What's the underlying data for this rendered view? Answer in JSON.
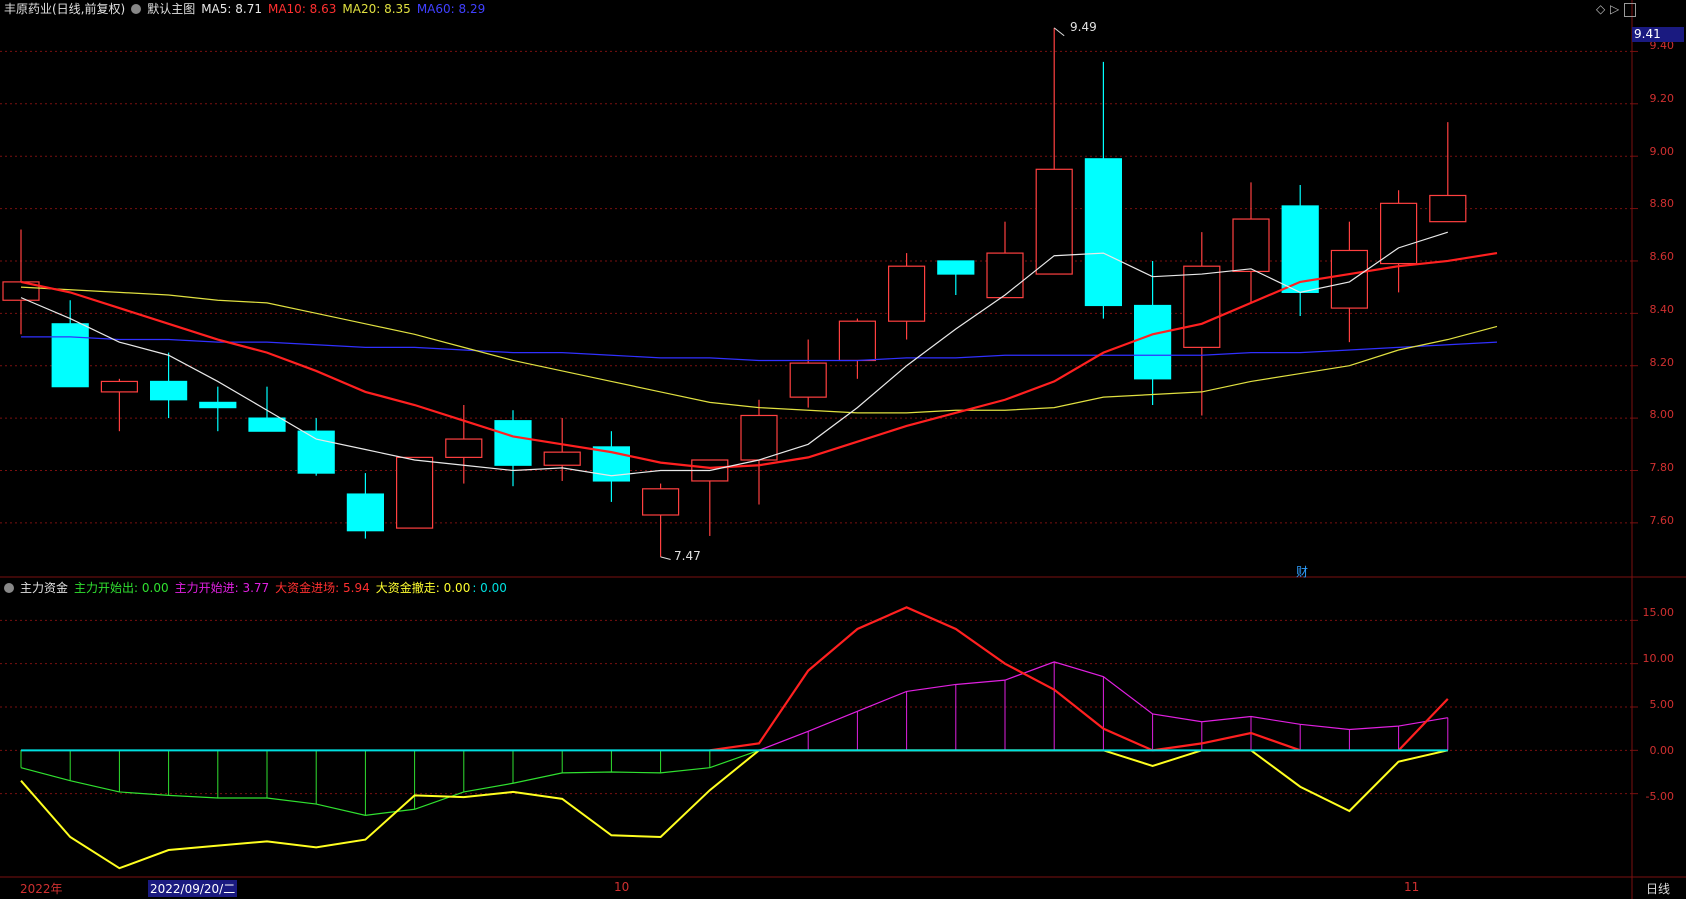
{
  "header": {
    "stock_title": "丰原药业(日线,前复权)",
    "main_chart_label": "默认主图",
    "ma5": "MA5: 8.71",
    "ma10": "MA10: 8.63",
    "ma20": "MA20: 8.35",
    "ma60": "MA60: 8.29"
  },
  "sub_header": {
    "indicator_name": "主力资金",
    "line1": "主力开始出: 0.00",
    "line2": "主力开始进: 3.77",
    "line3": "大资金进场: 5.94",
    "line4": "大资金撤走: 0.00",
    "line5": ": 0.00"
  },
  "price_panel": {
    "current_price_tag": "9.41",
    "high_annotation": "9.49",
    "low_annotation": "7.47",
    "event_marker": "财",
    "y_ticks": [
      "9.40",
      "9.20",
      "9.00",
      "8.80",
      "8.60",
      "8.40",
      "8.20",
      "8.00",
      "7.80",
      "7.60"
    ]
  },
  "indicator_panel": {
    "y_ticks": [
      "15.00",
      "10.00",
      "5.00",
      "0.00",
      "-5.00"
    ]
  },
  "x_axis": {
    "label_year": "2022年",
    "label_cursor": "2022/09/20/二",
    "label_oct": "10",
    "label_nov": "11",
    "period_label": "日线"
  },
  "colors": {
    "up": "#ff4040",
    "down": "#00ffff",
    "ma5": "#e8e8e8",
    "ma10": "#ff2020",
    "ma20": "#e0e040",
    "ma60": "#3030ff",
    "grid": "#7a1010",
    "ind_green": "#30e030",
    "ind_magenta": "#e020e0",
    "ind_red": "#ff2020",
    "ind_yellow": "#ffff20",
    "ind_cyan": "#00e0e0"
  },
  "chart_data": [
    {
      "type": "candlestick",
      "title": "丰原药业(日线,前复权)",
      "ylim": [
        7.42,
        9.52
      ],
      "ohlc": [
        [
          8.45,
          8.72,
          8.32,
          8.52
        ],
        [
          8.36,
          8.45,
          8.12,
          8.12
        ],
        [
          8.1,
          8.15,
          7.95,
          8.14
        ],
        [
          8.14,
          8.25,
          8.0,
          8.07
        ],
        [
          8.06,
          8.12,
          7.95,
          8.04
        ],
        [
          8.0,
          8.12,
          7.95,
          7.95
        ],
        [
          7.95,
          8.0,
          7.78,
          7.79
        ],
        [
          7.71,
          7.79,
          7.54,
          7.57
        ],
        [
          7.58,
          7.85,
          7.58,
          7.85
        ],
        [
          7.85,
          8.05,
          7.75,
          7.92
        ],
        [
          7.99,
          8.03,
          7.74,
          7.82
        ],
        [
          7.82,
          8.0,
          7.76,
          7.87
        ],
        [
          7.89,
          7.95,
          7.68,
          7.76
        ],
        [
          7.63,
          7.75,
          7.47,
          7.73
        ],
        [
          7.76,
          7.84,
          7.55,
          7.84
        ],
        [
          7.84,
          8.07,
          7.67,
          8.01
        ],
        [
          8.08,
          8.3,
          8.04,
          8.21
        ],
        [
          8.22,
          8.38,
          8.15,
          8.37
        ],
        [
          8.37,
          8.63,
          8.3,
          8.58
        ],
        [
          8.6,
          8.6,
          8.47,
          8.55
        ],
        [
          8.46,
          8.75,
          8.46,
          8.63
        ],
        [
          8.55,
          9.49,
          8.55,
          8.95
        ],
        [
          8.99,
          9.36,
          8.38,
          8.43
        ],
        [
          8.43,
          8.6,
          8.05,
          8.15
        ],
        [
          8.27,
          8.71,
          8.01,
          8.58
        ],
        [
          8.56,
          8.9,
          8.44,
          8.76
        ],
        [
          8.81,
          8.89,
          8.39,
          8.48
        ],
        [
          8.42,
          8.75,
          8.29,
          8.64
        ],
        [
          8.59,
          8.87,
          8.48,
          8.82
        ],
        [
          8.75,
          9.13,
          8.75,
          8.85
        ]
      ],
      "ma5": [
        8.46,
        8.38,
        8.29,
        8.24,
        8.14,
        8.03,
        7.92,
        7.88,
        7.84,
        7.82,
        7.8,
        7.81,
        7.78,
        7.8,
        7.8,
        7.84,
        7.9,
        8.04,
        8.2,
        8.34,
        8.47,
        8.62,
        8.63,
        8.54,
        8.55,
        8.57,
        8.48,
        8.52,
        8.65,
        8.71
      ],
      "ma10": [
        8.52,
        8.48,
        8.42,
        8.36,
        8.3,
        8.25,
        8.18,
        8.1,
        8.05,
        7.99,
        7.93,
        7.9,
        7.87,
        7.83,
        7.81,
        7.82,
        7.85,
        7.91,
        7.97,
        8.02,
        8.07,
        8.14,
        8.25,
        8.32,
        8.36,
        8.44,
        8.52,
        8.55,
        8.58,
        8.6,
        8.63
      ],
      "ma20": [
        8.5,
        8.49,
        8.48,
        8.47,
        8.45,
        8.44,
        8.4,
        8.36,
        8.32,
        8.27,
        8.22,
        8.18,
        8.14,
        8.1,
        8.06,
        8.04,
        8.03,
        8.02,
        8.02,
        8.03,
        8.03,
        8.04,
        8.08,
        8.09,
        8.1,
        8.14,
        8.17,
        8.2,
        8.26,
        8.3,
        8.35
      ],
      "ma60": [
        8.31,
        8.31,
        8.3,
        8.3,
        8.29,
        8.29,
        8.28,
        8.27,
        8.27,
        8.26,
        8.25,
        8.25,
        8.24,
        8.23,
        8.23,
        8.22,
        8.22,
        8.22,
        8.23,
        8.23,
        8.24,
        8.24,
        8.24,
        8.24,
        8.24,
        8.25,
        8.25,
        8.26,
        8.27,
        8.28,
        8.29
      ]
    },
    {
      "type": "line",
      "title": "主力资金",
      "ylim": [
        -14.5,
        18.5
      ],
      "series": [
        {
          "name": "主力开始出",
          "values": [
            -2,
            -3.5,
            -4.8,
            -5.2,
            -5.5,
            -5.5,
            -6.2,
            -7.5,
            -6.8,
            -4.8,
            -3.8,
            -2.6,
            -2.5,
            -2.6,
            -2,
            0,
            0,
            0,
            0,
            0,
            0,
            0,
            0,
            0,
            0,
            0,
            0,
            0,
            0,
            0
          ]
        },
        {
          "name": "主力开始进",
          "values": [
            0,
            0,
            0,
            0,
            0,
            0,
            0,
            0,
            0,
            0,
            0,
            0,
            0,
            0,
            0,
            0,
            2.2,
            4.5,
            6.8,
            7.6,
            8.1,
            10.2,
            8.5,
            4.2,
            3.3,
            3.9,
            3.0,
            2.4,
            2.8,
            3.77
          ]
        },
        {
          "name": "大资金进场",
          "values": [
            null,
            null,
            null,
            null,
            null,
            null,
            null,
            null,
            null,
            null,
            null,
            null,
            null,
            null,
            0,
            0.8,
            9.2,
            14,
            16.5,
            14,
            10,
            7,
            2.5,
            0,
            0.8,
            2,
            0,
            null,
            0,
            5.94
          ]
        },
        {
          "name": "大资金撤走",
          "values": [
            -3.5,
            -10,
            -13.6,
            -11.5,
            -11,
            -10.5,
            -11.2,
            -10.3,
            -5.2,
            -5.4,
            -4.8,
            -5.6,
            -9.8,
            -10,
            -4.6,
            0,
            0,
            0,
            0,
            0,
            0,
            0,
            0,
            -1.8,
            0,
            0,
            -4.2,
            -7,
            -1.3,
            0
          ]
        },
        {
          "name": "",
          "values": [
            0,
            0,
            0,
            0,
            0,
            0,
            0,
            0,
            0,
            0,
            0,
            0,
            0,
            0,
            0,
            0,
            0,
            0,
            0,
            0,
            0,
            0,
            0,
            0,
            0,
            0,
            0,
            0,
            0,
            0
          ]
        }
      ]
    }
  ]
}
